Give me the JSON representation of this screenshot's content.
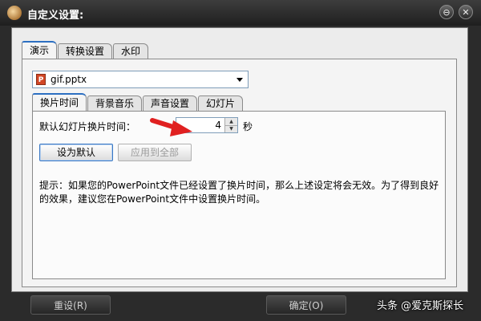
{
  "window": {
    "title": "自定义设置:",
    "minimize_glyph": "⊖",
    "close_glyph": "✕"
  },
  "main_tabs": [
    {
      "label": "演示",
      "active": true
    },
    {
      "label": "转换设置",
      "active": false
    },
    {
      "label": "水印",
      "active": false
    }
  ],
  "file_select": {
    "value": "gif.pptx",
    "icon": "powerpoint-file-icon",
    "icon_letter": "P"
  },
  "sub_tabs": [
    {
      "label": "换片时间",
      "active": true
    },
    {
      "label": "背景音乐",
      "active": false
    },
    {
      "label": "声音设置",
      "active": false
    },
    {
      "label": "幻灯片",
      "active": false
    }
  ],
  "slide_time": {
    "label": "默认幻灯片换片时间：",
    "value": "4",
    "unit": "秒"
  },
  "buttons": {
    "set_default": "设为默认",
    "apply_all": "应用到全部"
  },
  "hint": "提示：如果您的PowerPoint文件已经设置了换片时间，那么上述设定将会无效。为了得到良好的效果，建议您在PowerPoint文件中设置换片时间。",
  "footer": {
    "reset": "重设(R)",
    "ok": "确定(O)"
  },
  "watermark": "头条 @爱克斯探长",
  "colors": {
    "accent": "#2c6fc2",
    "arrow": "#e02020",
    "titlebar": "#2b2b2b"
  }
}
